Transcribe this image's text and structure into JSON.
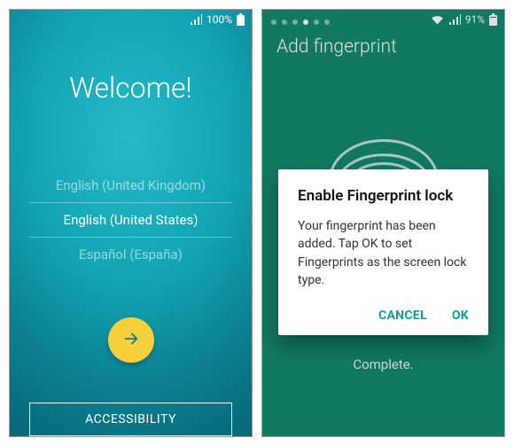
{
  "left": {
    "status": {
      "battery_pct": "100%"
    },
    "title": "Welcome!",
    "languages": [
      "English (United Kingdom)",
      "English (United States)",
      "Español (España)"
    ],
    "accessibility_label": "ACCESSIBILITY"
  },
  "right": {
    "status": {
      "battery_pct": "91%"
    },
    "title": "Add fingerprint",
    "dialog": {
      "title": "Enable Fingerprint lock",
      "body": "Your fingerprint has been added. Tap OK to set Fingerprints as the screen lock type.",
      "cancel": "CANCEL",
      "ok": "OK"
    },
    "complete": "Complete."
  }
}
